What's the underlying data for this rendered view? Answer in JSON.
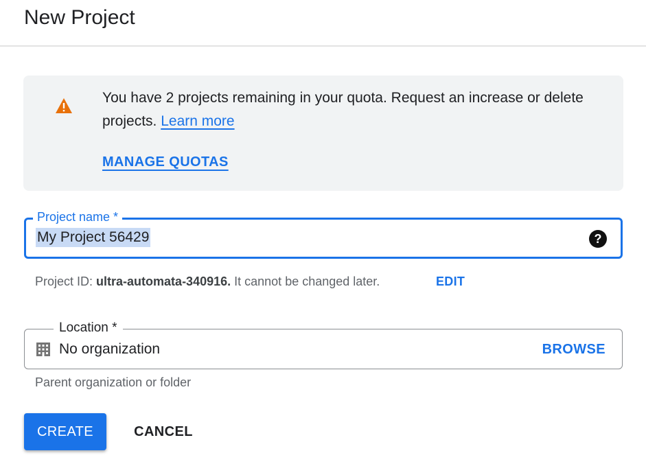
{
  "header": {
    "title": "New Project"
  },
  "quota_notice": {
    "icon": "warning-icon",
    "icon_color": "#e8710a",
    "message": "You have 2 projects remaining in your quota. Request an increase or delete projects.",
    "learn_more_label": "Learn more",
    "manage_quotas_label": "MANAGE QUOTAS"
  },
  "project_name": {
    "label": "Project name *",
    "value": "My Project 56429",
    "help_icon": "help-icon"
  },
  "project_id": {
    "prefix": "Project ID:",
    "id": "ultra-automata-340916.",
    "suffix": "It cannot be changed later.",
    "edit_label": "EDIT"
  },
  "location": {
    "label": "Location *",
    "icon": "building-icon",
    "value": "No organization",
    "browse_label": "BROWSE",
    "helper": "Parent organization or folder"
  },
  "actions": {
    "create_label": "CREATE",
    "cancel_label": "CANCEL"
  },
  "colors": {
    "accent": "#1a73e8",
    "notice_bg": "#f1f3f4",
    "warning": "#e8710a"
  }
}
